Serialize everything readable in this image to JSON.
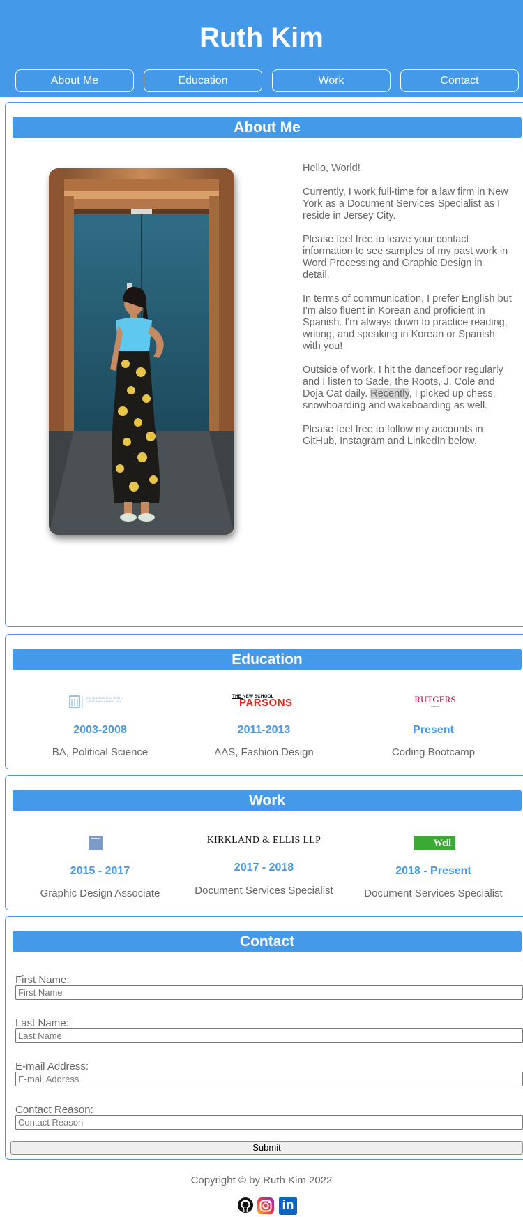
{
  "header": {
    "title": "Ruth Kim",
    "nav": [
      "About Me",
      "Education",
      "Work",
      "Contact"
    ]
  },
  "about": {
    "heading": "About Me",
    "paragraphs": {
      "p1": "Hello, World!",
      "p2": "Currently, I work full-time for a law firm in New York as a Document Services Specialist as I reside in Jersey City.",
      "p3": "Please feel free to leave your contact information to see samples of my past work in Word Processing and Graphic Design in detail.",
      "p4": "In terms of communication, I prefer English but I'm also fluent in Korean and proficient in Spanish. I'm always down to practice reading, writing, and speaking in Korean or Spanish with you!",
      "p5_a": "Outside of work, I hit the dancefloor regularly and I listen to Sade, the Roots, J. Cole and Doja Cat daily. ",
      "p5_highlight": "Recently",
      "p5_b": ", I picked up chess, snowboarding and wakeboarding as well.",
      "p6": "Please feel free to follow my accounts in GitHub, Instagram and LinkedIn below."
    }
  },
  "education": {
    "heading": "Education",
    "items": [
      {
        "logo_text": "THE UNIVERSITY of NORTH CAROLINA at CHAPEL HILL",
        "years": "2003-2008",
        "desc": "BA, Political Science"
      },
      {
        "logo_text_top": "THE NEW SCHOOL",
        "logo_text": "PARSONS",
        "years": "2011-2013",
        "desc": "AAS, Fashion Design"
      },
      {
        "logo_text": "RUTGERS",
        "years": "Present",
        "desc": "Coding Bootcamp"
      }
    ]
  },
  "work": {
    "heading": "Work",
    "items": [
      {
        "years": "2015 - 2017",
        "desc": "Graphic Design Associate"
      },
      {
        "logo_text": "KIRKLAND & ELLIS LLP",
        "years": "2017 - 2018",
        "desc": "Document Services Specialist"
      },
      {
        "logo_text": "Weil",
        "years": "2018 - Present",
        "desc": "Document Services Specialist"
      }
    ]
  },
  "contact": {
    "heading": "Contact",
    "fields": [
      {
        "label": "First Name:",
        "placeholder": "First Name"
      },
      {
        "label": "Last Name:",
        "placeholder": "Last Name"
      },
      {
        "label": "E-mail Address:",
        "placeholder": "E-mail Address"
      },
      {
        "label": "Contact Reason:",
        "placeholder": "Contact Reason"
      }
    ],
    "submit": "Submit"
  },
  "footer": {
    "copyright": "Copyright © by Ruth Kim 2022",
    "social_icons": [
      "github-icon",
      "instagram-icon",
      "linkedin-icon"
    ],
    "linkedin_glyph": "in"
  },
  "colors": {
    "accent": "#4499e9",
    "text": "#666666",
    "parsons_red": "#e1251b",
    "rutgers_red": "#cc0033",
    "weil_green": "#3aaa35"
  }
}
